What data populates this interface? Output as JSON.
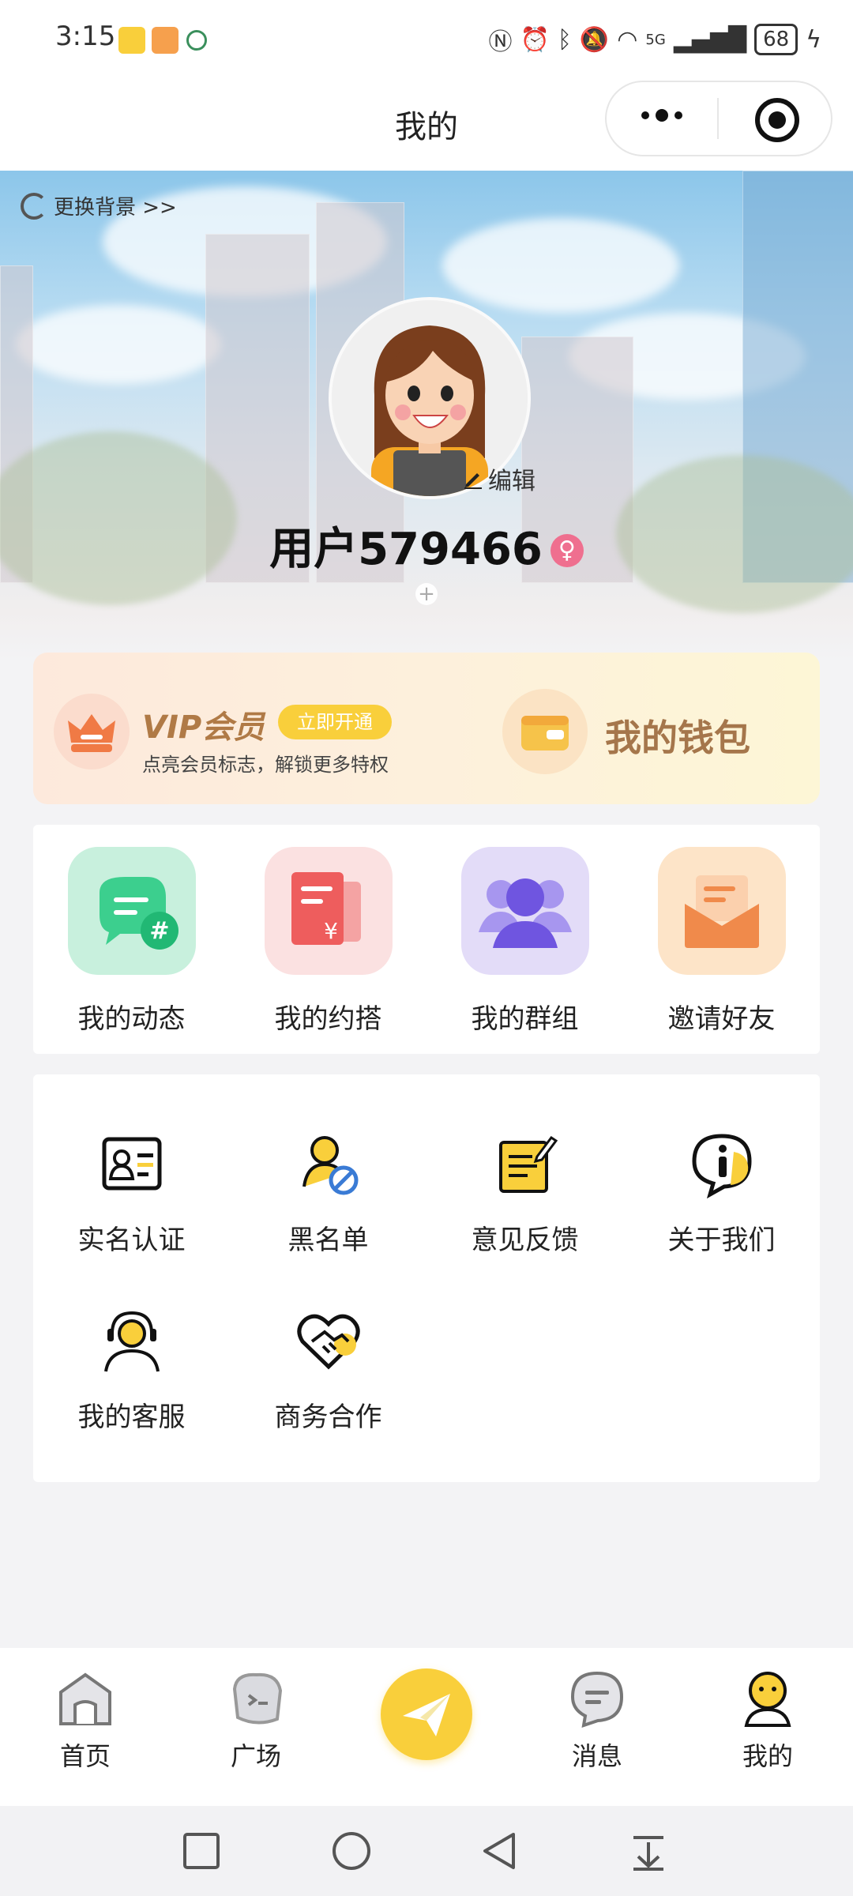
{
  "status_bar": {
    "time": "3:15",
    "battery": "68",
    "signal_label": "5G"
  },
  "header": {
    "title": "我的"
  },
  "profile": {
    "change_background": "更换背景 >>",
    "edit_label": "编辑",
    "username": "用户579466",
    "gender_icon": "female-icon"
  },
  "vip": {
    "title": "VIP会员",
    "open_button": "立即开通",
    "subtitle": "点亮会员标志，解锁更多特权",
    "wallet_label": "我的钱包"
  },
  "quick_actions": [
    {
      "label": "我的动态",
      "icon": "chat-hashtag-icon",
      "color": "#c8f0dd"
    },
    {
      "label": "我的约搭",
      "icon": "receipt-icon",
      "color": "#fbe1e1"
    },
    {
      "label": "我的群组",
      "icon": "group-icon",
      "color": "#e3dcf8"
    },
    {
      "label": "邀请好友",
      "icon": "invite-envelope-icon",
      "color": "#fde4c8"
    }
  ],
  "tools": [
    {
      "label": "实名认证",
      "icon": "id-card-icon"
    },
    {
      "label": "黑名单",
      "icon": "blocked-user-icon"
    },
    {
      "label": "意见反馈",
      "icon": "feedback-note-icon"
    },
    {
      "label": "关于我们",
      "icon": "info-bubble-icon"
    },
    {
      "label": "我的客服",
      "icon": "customer-service-icon"
    },
    {
      "label": "商务合作",
      "icon": "handshake-heart-icon"
    }
  ],
  "tabbar": {
    "home": "首页",
    "square": "广场",
    "messages": "消息",
    "mine": "我的"
  },
  "colors": {
    "accent": "#f9cf3b",
    "vip_gold": "#b07a46",
    "female_pink": "#ef6f8f"
  }
}
